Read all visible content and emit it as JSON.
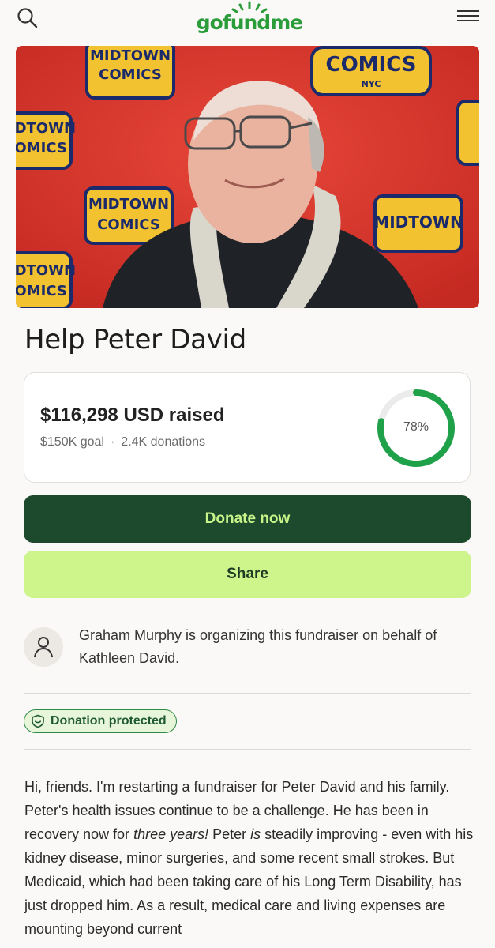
{
  "header": {
    "logo_text": "gofundme",
    "icons": {
      "search": "search-icon",
      "menu": "hamburger-menu-icon"
    }
  },
  "hero": {
    "banner_text": [
      "MIDTOWN",
      "COMICS",
      "NYC"
    ],
    "colors": {
      "backdrop": "#d8362c",
      "banner": "#f2c230"
    }
  },
  "campaign": {
    "title": "Help Peter David",
    "raised": "$116,298 USD raised",
    "goal": "$150K goal",
    "separator": "·",
    "donations": "2.4K donations",
    "progress_percent": 78,
    "progress_label": "78%"
  },
  "actions": {
    "donate_label": "Donate now",
    "share_label": "Share"
  },
  "organizer": {
    "text": "Graham Murphy is organizing this fundraiser on behalf of Kathleen David."
  },
  "badge": {
    "label": "Donation protected",
    "icon": "shield-icon"
  },
  "story": {
    "p1_a": "Hi, friends. I'm restarting a fundraiser for Peter David and his family. Peter's health issues continue to be a challenge. He has been in recovery now for ",
    "p1_em1": "three years!",
    "p1_b": " Peter ",
    "p1_em2": "is",
    "p1_c": " steadily improving - even with his kidney disease, minor surgeries, and some recent small strokes. But Medicaid, which had been taking care of his Long Term Disability, has just dropped him. As a result, medical care and living expenses are mounting beyond current"
  },
  "colors": {
    "brand_green": "#2a9d3a",
    "donate_bg": "#1d4a2c",
    "donate_text": "#c8f58a",
    "share_bg": "#cdf58c",
    "ring_track": "#ebebeb",
    "ring_fill": "#1fa14a"
  }
}
